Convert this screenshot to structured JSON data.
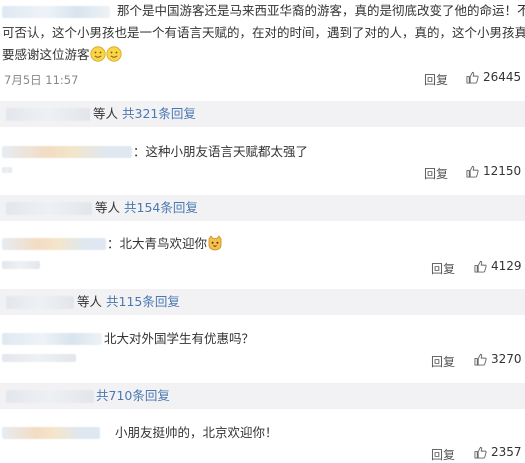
{
  "comments": [
    {
      "text_line1": "那个是中国游客还是马来西亚华裔的游客，真的是彻底改变了他的命运！不",
      "text_line2": "可否认，这个小男孩也是一个有语言天赋的，在对的时间，遇到了对的人，真的，这个小男孩真的",
      "text_line3": "要感谢这位游客",
      "time": "7月5日 11:57",
      "reply_label": "回复",
      "likes": "26445",
      "replies_summary_prefix": "等人",
      "replies_summary_link": "共321条回复"
    },
    {
      "text": "：这种小朋友语言天赋都太强了",
      "reply_label": "回复",
      "likes": "12150",
      "replies_summary_prefix": "等人",
      "replies_summary_link": "共154条回复"
    },
    {
      "text": "：北大青鸟欢迎你",
      "reply_label": "回复",
      "likes": "4129",
      "replies_summary_prefix": "等人",
      "replies_summary_link": "共115条回复"
    },
    {
      "text": "北大对外国学生有优惠吗？",
      "reply_label": "回复",
      "likes": "3270",
      "replies_summary_link": "共710条回复"
    },
    {
      "text": "小朋友挺帅的，北京欢迎你！",
      "reply_label": "回复",
      "likes": "2357"
    }
  ],
  "icons": {
    "like": "thumbs-up-icon",
    "emoji_smile": "smile-emoji-icon",
    "emoji_cat": "cat-emoji-icon"
  },
  "colors": {
    "link": "#4a78b0",
    "reply_bar_bg": "#f2f2f5",
    "meta": "#888888"
  }
}
